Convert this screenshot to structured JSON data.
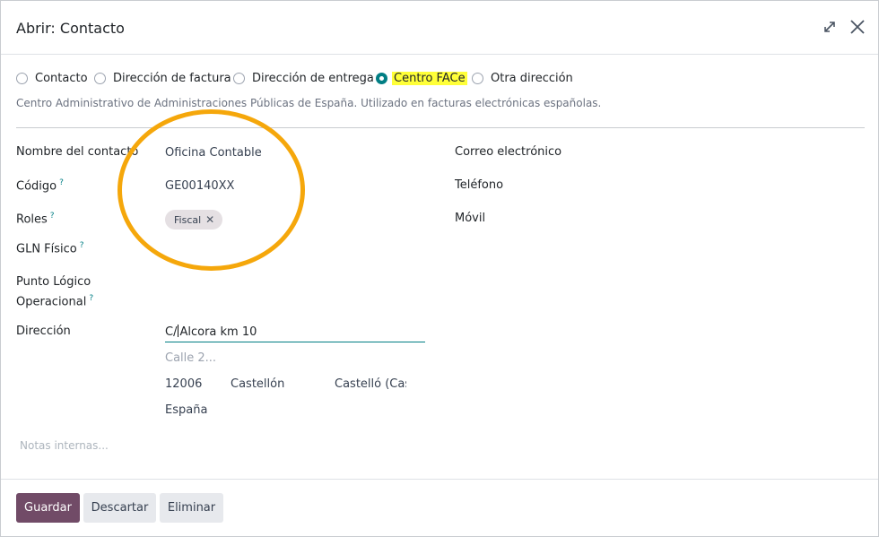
{
  "dialog": {
    "title": "Abrir: Contacto",
    "expand_icon": "expand-arrows-icon",
    "close_icon": "close-icon"
  },
  "address_type": {
    "options": [
      {
        "label": "Contacto",
        "checked": false
      },
      {
        "label": "Dirección de factura",
        "checked": false
      },
      {
        "label": "Dirección de entrega",
        "checked": false
      },
      {
        "label": "Centro FACe",
        "checked": true
      },
      {
        "label": "Otra dirección",
        "checked": false
      }
    ],
    "description": "Centro Administrativo de Administraciones Públicas de España. Utilizado en facturas electrónicas españolas."
  },
  "form": {
    "contact_name_label": "Nombre del contacto",
    "contact_name_value": "Oficina Contable",
    "code_label": "Código",
    "code_value": "GE00140XX",
    "roles_label": "Roles",
    "roles_tag": "Fiscal",
    "gln_label": "GLN Físico",
    "punto_label_line1": "Punto Lógico",
    "punto_label_line2": "Operacional",
    "help_mark": "?",
    "address_label": "Dirección",
    "street_before_caret": "C/",
    "street_after_caret": "Alcora km 10",
    "street2_placeholder": "Calle 2...",
    "zip": "12006",
    "city": "Castellón",
    "state": "Castelló (Cas",
    "country": "España",
    "email_label": "Correo electrónico",
    "phone_label": "Teléfono",
    "mobile_label": "Móvil",
    "notes_placeholder": "Notas internas..."
  },
  "footer": {
    "save_label": "Guardar",
    "discard_label": "Descartar",
    "delete_label": "Eliminar"
  },
  "colors": {
    "primary": "#714b67",
    "accent": "#017e84",
    "highlight": "#ffff38",
    "annotation": "#f5a70b"
  }
}
